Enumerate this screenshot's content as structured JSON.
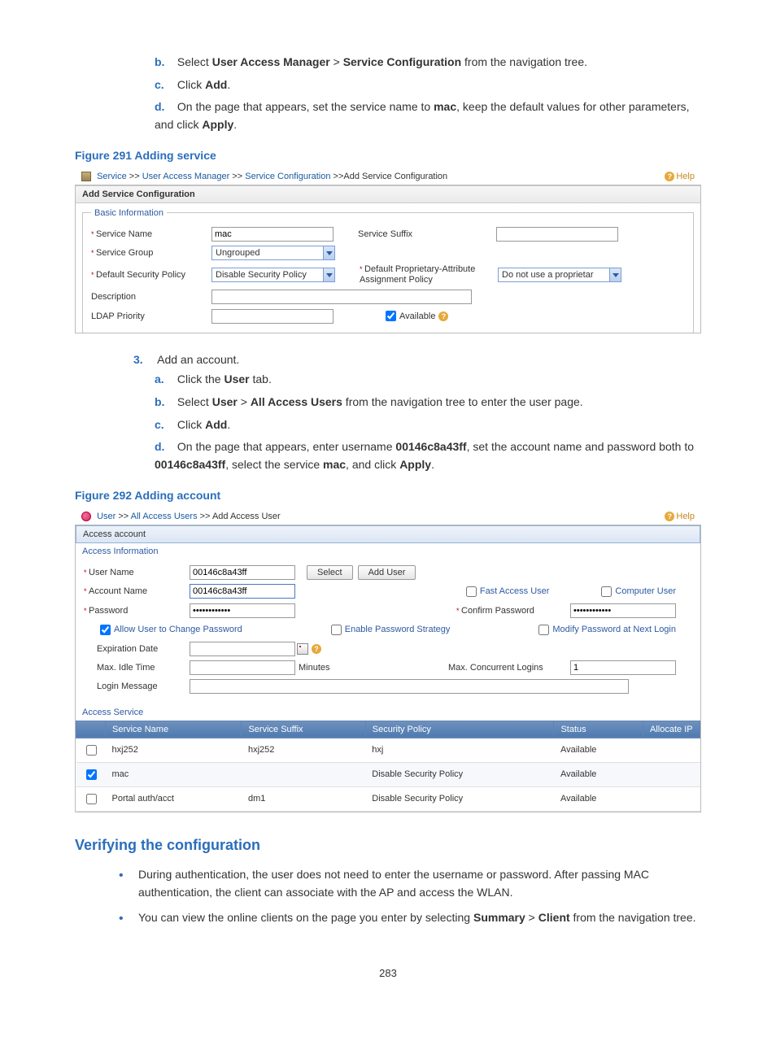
{
  "step_b": "Select ",
  "step_b_bold1": "User Access Manager",
  "step_b_sep": " > ",
  "step_b_bold2": "Service Configuration",
  "step_b_tail": " from the navigation tree.",
  "step_c": "Click ",
  "step_c_bold": "Add",
  "step_c_tail": ".",
  "step_d_pre": "On the page that appears, set the service name to ",
  "step_d_bold1": "mac",
  "step_d_mid": ", keep the default values for other parameters, and click ",
  "step_d_bold2": "Apply",
  "step_d_tail": ".",
  "fig291": "Figure 291 Adding service",
  "ss1": {
    "bc1": "Service",
    "bc2": "User Access Manager",
    "bc3": "Service Configuration",
    "bc_tail": "Add Service Configuration",
    "help": "Help",
    "titlebar": "Add Service Configuration",
    "legend": "Basic Information",
    "l_service_name": "Service Name",
    "v_service_name": "mac",
    "l_service_suffix": "Service Suffix",
    "l_service_group": "Service Group",
    "v_service_group": "Ungrouped",
    "l_def_sec": "Default Security Policy",
    "v_def_sec": "Disable Security Policy",
    "l_def_prop": "Default Proprietary-Attribute Assignment Policy",
    "v_def_prop": "Do not use a proprietar",
    "l_desc": "Description",
    "l_ldap": "LDAP Priority",
    "l_avail": "Available"
  },
  "step3": "Add an account.",
  "s3a_pre": "Click the ",
  "s3a_bold": "User",
  "s3a_tail": " tab.",
  "s3b_pre": "Select ",
  "s3b_bold1": "User",
  "s3b_sep": " > ",
  "s3b_bold2": "All Access Users",
  "s3b_tail": " from the navigation tree to enter the user page.",
  "s3c_pre": "Click ",
  "s3c_bold": "Add",
  "s3c_tail": ".",
  "s3d_pre": "On the page that appears, enter username ",
  "s3d_bold1": "00146c8a43ff",
  "s3d_mid1": ", set the account name and password both to ",
  "s3d_bold2": "00146c8a43ff",
  "s3d_mid2": ", select the service ",
  "s3d_bold3": "mac",
  "s3d_mid3": ", and click ",
  "s3d_bold4": "Apply",
  "s3d_tail": ".",
  "fig292": "Figure 292 Adding account",
  "ss2": {
    "bc1": "User",
    "bc2": "All Access Users",
    "bc_tail": "Add Access User",
    "help": "Help",
    "titlebar": "Access account",
    "legend_info": "Access Information",
    "l_user_name": "User Name",
    "v_user_name": "00146c8a43ff",
    "btn_select": "Select",
    "btn_adduser": "Add User",
    "l_account_name": "Account Name",
    "v_account_name": "00146c8a43ff",
    "l_fast": "Fast Access User",
    "l_computer": "Computer User",
    "l_password": "Password",
    "v_password": "••••••••••••",
    "l_confirm": "Confirm Password",
    "v_confirm": "••••••••••••",
    "l_allow": "Allow User to Change Password",
    "l_enable_strat": "Enable Password Strategy",
    "l_modify_next": "Modify Password at Next Login",
    "l_exp": "Expiration Date",
    "l_idle": "Max. Idle Time",
    "l_minutes": "Minutes",
    "l_max_con": "Max. Concurrent Logins",
    "v_max_con": "1",
    "l_login_msg": "Login Message",
    "legend_svc": "Access Service",
    "th_name": "Service Name",
    "th_suffix": "Service Suffix",
    "th_policy": "Security Policy",
    "th_status": "Status",
    "th_alloc": "Allocate IP",
    "rows": [
      {
        "chk": false,
        "name": "hxj252",
        "suffix": "hxj252",
        "policy": "hxj",
        "status": "Available"
      },
      {
        "chk": true,
        "name": "mac",
        "suffix": "",
        "policy": "Disable Security Policy",
        "status": "Available"
      },
      {
        "chk": false,
        "name": "Portal auth/acct",
        "suffix": "dm1",
        "policy": "Disable Security Policy",
        "status": "Available"
      }
    ]
  },
  "verify_heading": "Verifying the configuration",
  "verify_b1_pre": "During authentication, the user does not need to enter the username or password. After passing MAC authentication, the client can associate with the AP and access the WLAN.",
  "verify_b2_pre": "You can view the online clients on the page you enter by selecting ",
  "verify_b2_bold1": "Summary",
  "verify_b2_sep": " > ",
  "verify_b2_bold2": "Client",
  "verify_b2_tail": " from the navigation tree.",
  "page_num": "283"
}
